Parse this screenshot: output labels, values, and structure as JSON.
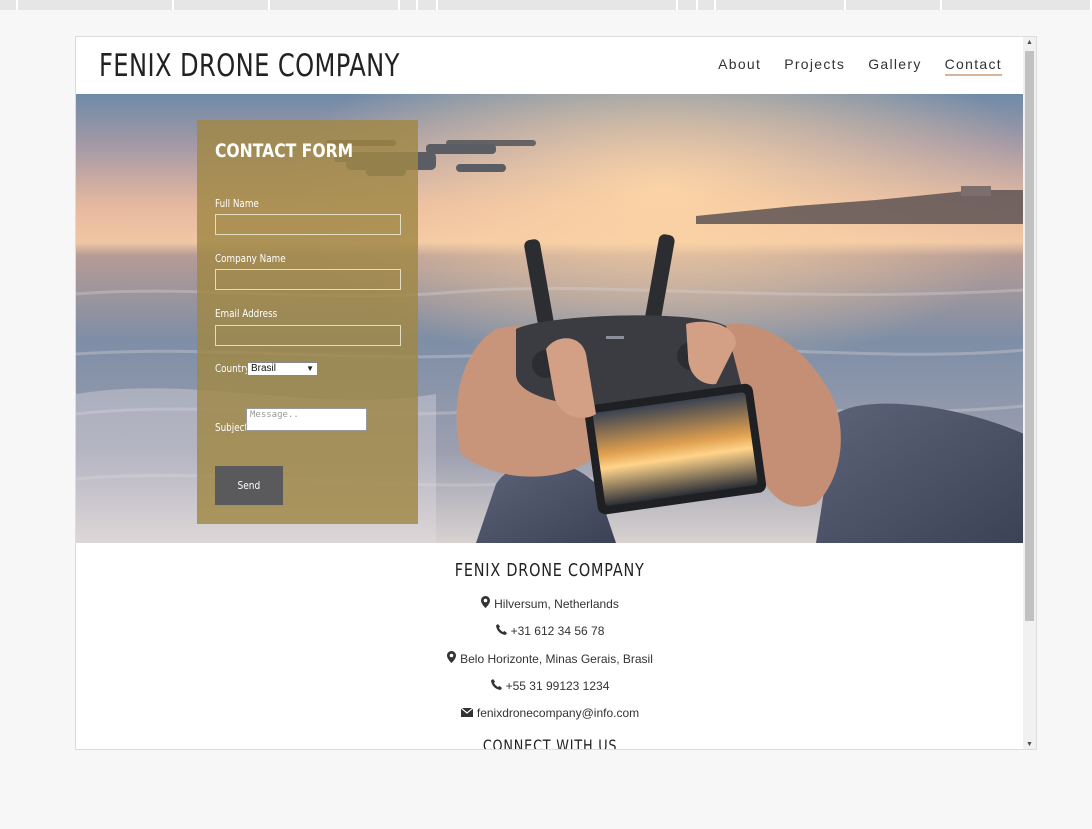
{
  "site": {
    "brand": "FENIX DRONE COMPANY"
  },
  "nav": {
    "items": [
      {
        "label": "About"
      },
      {
        "label": "Projects"
      },
      {
        "label": "Gallery"
      },
      {
        "label": "Contact"
      }
    ],
    "active": "Contact"
  },
  "form": {
    "title": "CONTACT FORM",
    "full_name_label": "Full Name",
    "company_label": "Company Name",
    "email_label": "Email Address",
    "country_label": "Country",
    "country_selected": "Brasil",
    "subject_label": "Subject",
    "subject_placeholder": "Message..",
    "send_label": "Send"
  },
  "footer": {
    "title": "FENIX DRONE COMPANY",
    "lines": [
      {
        "icon": "map-marker-icon",
        "text": "Hilversum, Netherlands"
      },
      {
        "icon": "phone-icon",
        "text": "+31 612 34 56 78"
      },
      {
        "icon": "map-marker-icon",
        "text": "Belo Horizonte, Minas Gerais, Brasil"
      },
      {
        "icon": "phone-icon",
        "text": "+55 31 99123 1234"
      },
      {
        "icon": "envelope-icon",
        "text": "fenixdronecompany@info.com"
      }
    ],
    "connect_title": "CONNECT WITH US"
  },
  "colors": {
    "panel": "#a08844",
    "button": "#5a5a5c",
    "nav_underline": "#d7b59a"
  }
}
